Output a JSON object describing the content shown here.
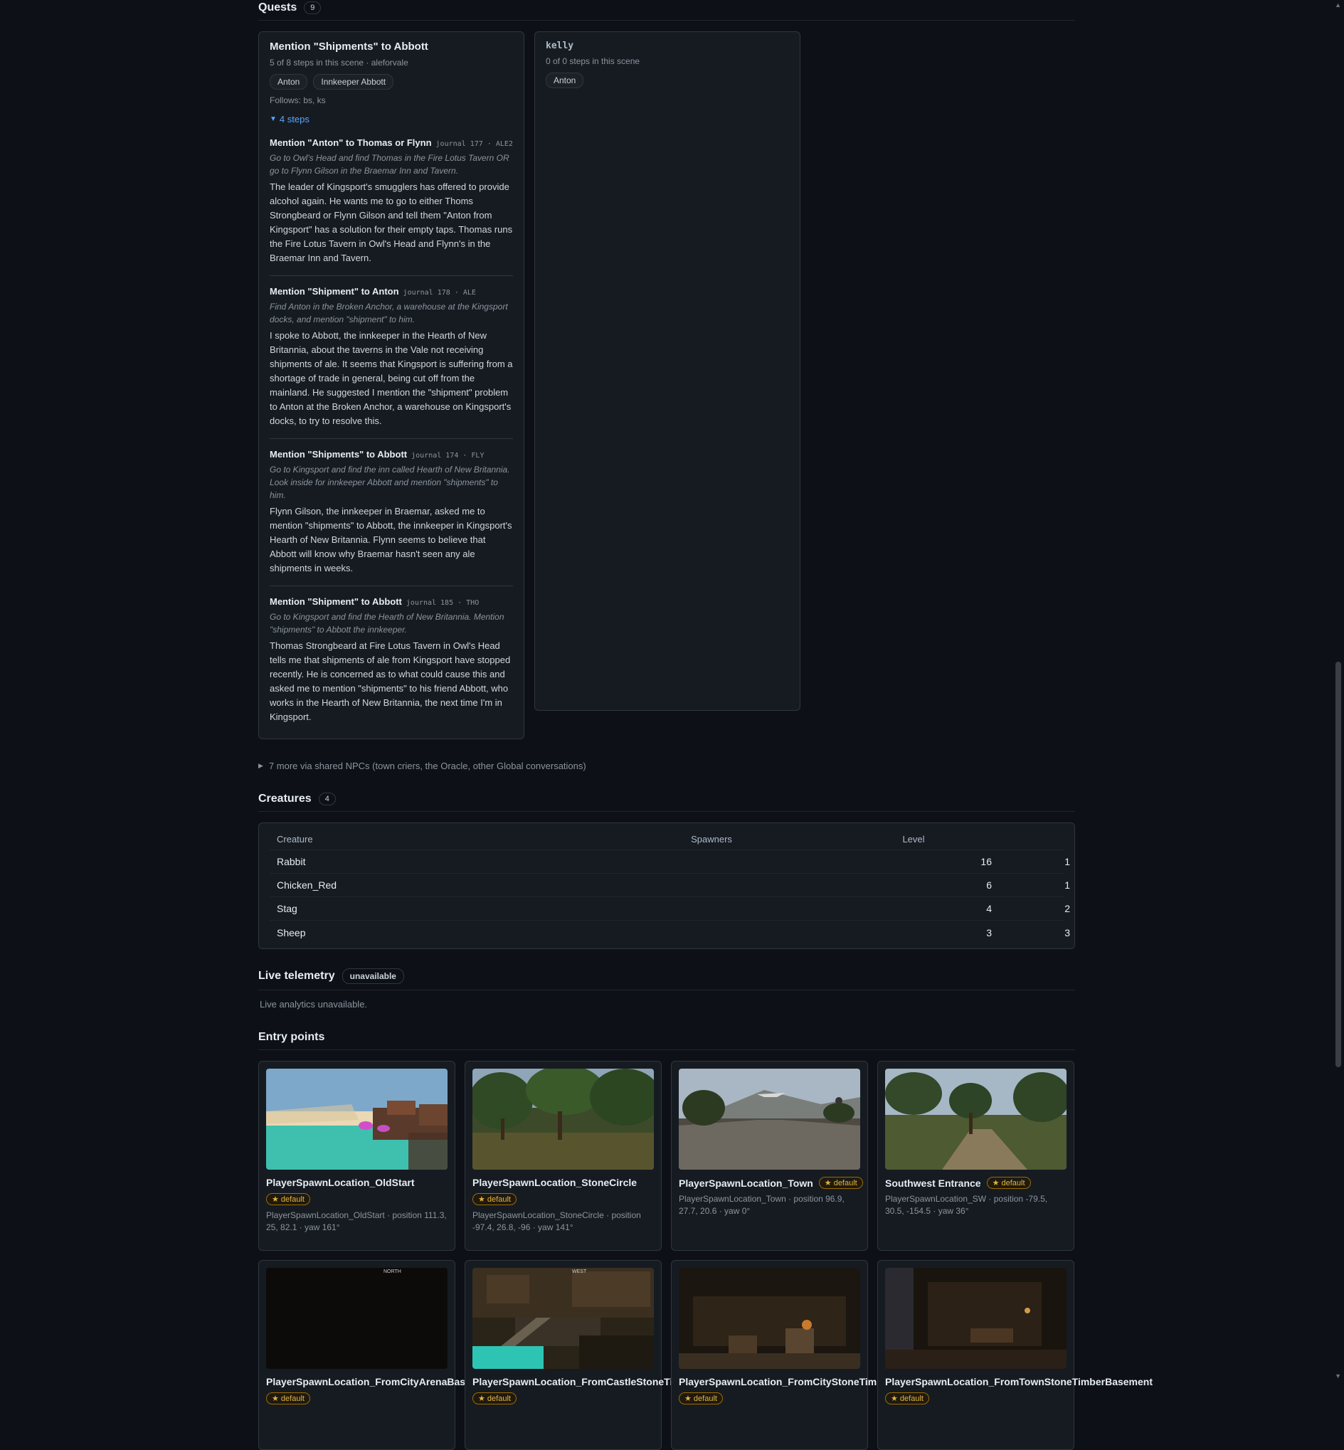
{
  "quests": {
    "title": "Quests",
    "count": "9",
    "cards": [
      {
        "title": "Mention \"Shipments\" to Abbott",
        "meta": "5 of 8 steps in this scene · aleforvale",
        "chips": [
          "Anton",
          "Innkeeper Abbott"
        ],
        "follows": "Follows: bs, ks",
        "steps_toggle": "4 steps",
        "steps": [
          {
            "title": "Mention \"Anton\" to Thomas or Flynn",
            "ref": "journal 177 · ALE2",
            "hint": "Go to Owl's Head and find Thomas in the Fire Lotus Tavern OR go to Flynn Gilson in the Braemar Inn and Tavern.",
            "body": "The leader of Kingsport's smugglers has offered to provide alcohol again. He wants me to go to either Thoms Strongbeard or Flynn Gilson and tell them \"Anton from Kingsport\" has a solution for their empty taps. Thomas runs the Fire Lotus Tavern in Owl's Head and Flynn's in the Braemar Inn and Tavern."
          },
          {
            "title": "Mention \"Shipment\" to Anton",
            "ref": "journal 178 · ALE",
            "hint": "Find Anton in the Broken Anchor, a warehouse at the Kingsport docks, and mention \"shipment\" to him.",
            "body": "I spoke to Abbott, the innkeeper in the Hearth of New Britannia, about the taverns in the Vale not receiving shipments of ale. It seems that Kingsport is suffering from a shortage of trade in general, being cut off from the mainland. He suggested I mention the \"shipment\" problem to Anton at the Broken Anchor, a warehouse on Kingsport's docks, to try to resolve this."
          },
          {
            "title": "Mention \"Shipments\" to Abbott",
            "ref": "journal 174 · FLY",
            "hint": "Go to Kingsport and find the inn called Hearth of New Britannia. Look inside for innkeeper Abbott and mention \"shipments\" to him.",
            "body": "Flynn Gilson, the innkeeper in Braemar, asked me to mention \"shipments\" to Abbott, the innkeeper in Kingsport's Hearth of New Britannia. Flynn seems to believe that Abbott will know why Braemar hasn't seen any ale shipments in weeks."
          },
          {
            "title": "Mention \"Shipment\" to Abbott",
            "ref": "journal 185 · THO",
            "hint": "Go to Kingsport and find the Hearth of New Britannia. Mention \"shipments\" to Abbott the innkeeper.",
            "body": "Thomas Strongbeard at Fire Lotus Tavern in Owl's Head tells me that shipments of ale from Kingsport have stopped recently. He is concerned as to what could cause this and asked me to mention \"shipments\" to his friend Abbott, who works in the Hearth of New Britannia, the next time I'm in Kingsport."
          }
        ]
      },
      {
        "title": "kelly",
        "meta": "0 of 0 steps in this scene",
        "chips": [
          "Anton"
        ]
      }
    ],
    "more": "7 more via shared NPCs (town criers, the Oracle, other Global conversations)"
  },
  "creatures": {
    "title": "Creatures",
    "count": "4",
    "headers": [
      "Creature",
      "Spawners",
      "Level"
    ],
    "rows": [
      {
        "name": "Rabbit",
        "spawners": "16",
        "level": "1"
      },
      {
        "name": "Chicken_Red",
        "spawners": "6",
        "level": "1"
      },
      {
        "name": "Stag",
        "spawners": "4",
        "level": "2"
      },
      {
        "name": "Sheep",
        "spawners": "3",
        "level": "3"
      }
    ]
  },
  "telemetry": {
    "title": "Live telemetry",
    "status": "unavailable",
    "message": "Live analytics unavailable."
  },
  "entry_points": {
    "title": "Entry points",
    "default_label": "★ default",
    "items": [
      {
        "name": "PlayerSpawnLocation_OldStart",
        "meta": "PlayerSpawnLocation_OldStart · position 111.3, 25, 82.1 · yaw 161°",
        "scene": "water"
      },
      {
        "name": "PlayerSpawnLocation_StoneCircle",
        "meta": "PlayerSpawnLocation_StoneCircle · position -97.4, 26.8, -96 · yaw 141°",
        "scene": "forest"
      },
      {
        "name": "PlayerSpawnLocation_Town",
        "meta": "PlayerSpawnLocation_Town · position 96.9, 27.7, 20.6 · yaw 0°",
        "scene": "road"
      },
      {
        "name": "Southwest Entrance",
        "meta": "PlayerSpawnLocation_SW · position -79.5, 30.5, -154.5 · yaw 36°",
        "scene": "trees"
      },
      {
        "name": "PlayerSpawnLocation_FromCityArenaBasement",
        "meta": "",
        "scene": "dark",
        "overlay": "NORTH"
      },
      {
        "name": "PlayerSpawnLocation_FromCastleStoneTimber",
        "meta": "",
        "scene": "house",
        "overlay": "WEST"
      },
      {
        "name": "PlayerSpawnLocation_FromCityStoneTimber",
        "meta": "",
        "scene": "cellar"
      },
      {
        "name": "PlayerSpawnLocation_FromTownStoneTimberBasement",
        "meta": "",
        "scene": "interior"
      }
    ]
  }
}
